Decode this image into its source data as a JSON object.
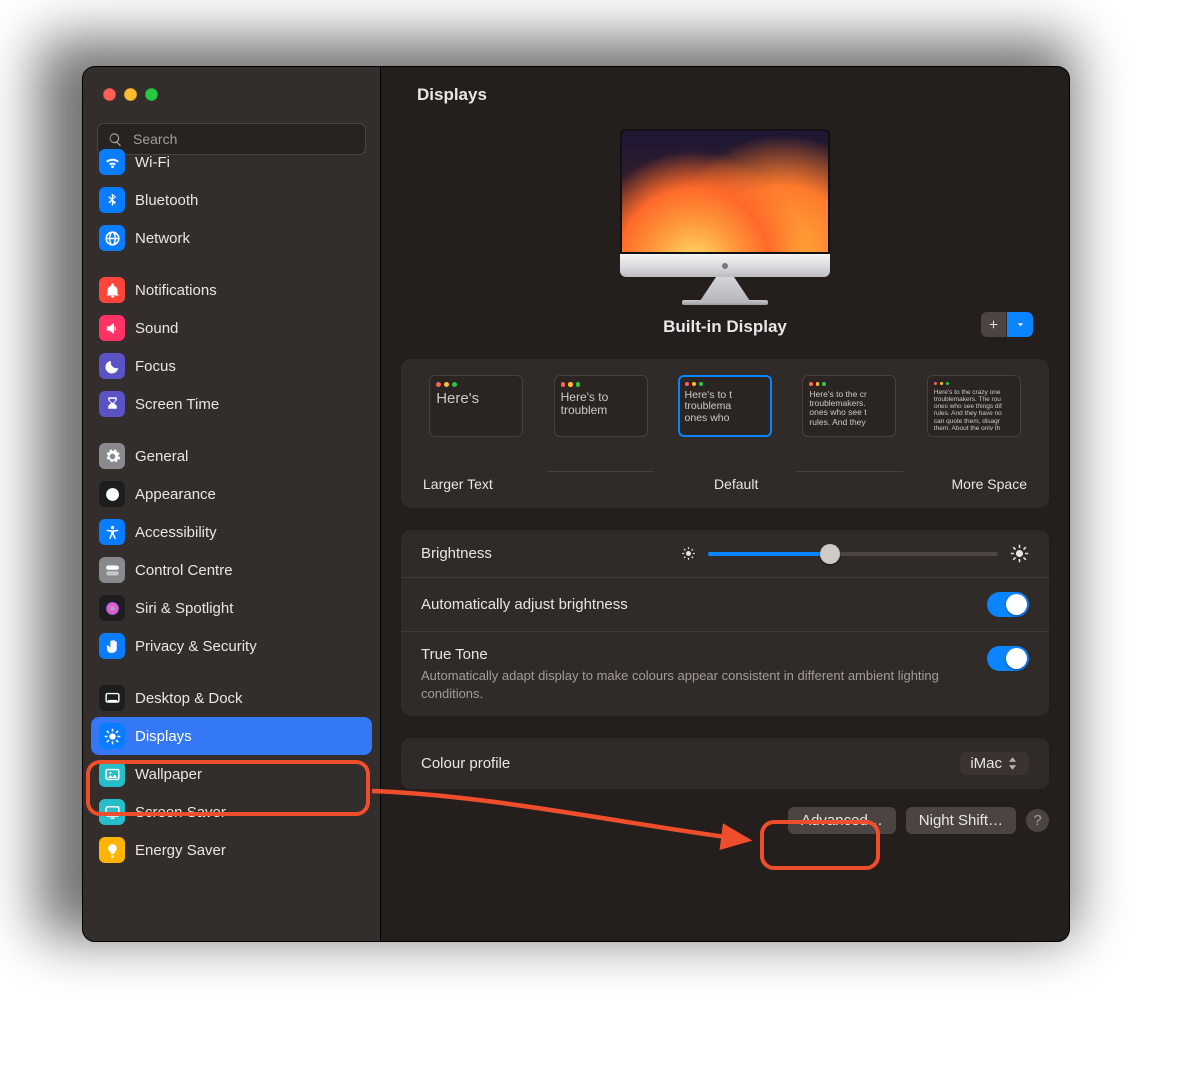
{
  "header": {
    "title": "Displays"
  },
  "search": {
    "placeholder": "Search"
  },
  "sidebar": {
    "groups": [
      [
        {
          "label": "Wi-Fi",
          "icon": "wifi",
          "bg": "#0a7cff"
        },
        {
          "label": "Bluetooth",
          "icon": "bluetooth",
          "bg": "#0a7cff"
        },
        {
          "label": "Network",
          "icon": "globe",
          "bg": "#0a7cff"
        }
      ],
      [
        {
          "label": "Notifications",
          "icon": "bell",
          "bg": "#ff453a"
        },
        {
          "label": "Sound",
          "icon": "speaker",
          "bg": "#ff3365"
        },
        {
          "label": "Focus",
          "icon": "moon",
          "bg": "#5a53c5"
        },
        {
          "label": "Screen Time",
          "icon": "hourglass",
          "bg": "#5a53c5"
        }
      ],
      [
        {
          "label": "General",
          "icon": "gear",
          "bg": "#8a8a8e"
        },
        {
          "label": "Appearance",
          "icon": "appearance",
          "bg": "#1d1d1f"
        },
        {
          "label": "Accessibility",
          "icon": "accessibility",
          "bg": "#0a7cff"
        },
        {
          "label": "Control Centre",
          "icon": "switches",
          "bg": "#8a8a8e"
        },
        {
          "label": "Siri & Spotlight",
          "icon": "siri",
          "bg": "#1d1d1f"
        },
        {
          "label": "Privacy & Security",
          "icon": "hand",
          "bg": "#0a7cff"
        }
      ],
      [
        {
          "label": "Desktop & Dock",
          "icon": "dock",
          "bg": "#1d1d1f"
        },
        {
          "label": "Displays",
          "icon": "sun",
          "bg": "#0a7cff",
          "selected": true
        },
        {
          "label": "Wallpaper",
          "icon": "photo",
          "bg": "#27beca"
        },
        {
          "label": "Screen Saver",
          "icon": "screensaver",
          "bg": "#27beca"
        },
        {
          "label": "Energy Saver",
          "icon": "bulb",
          "bg": "#ffb303"
        }
      ]
    ]
  },
  "display_name": "Built-in Display",
  "resolution": {
    "left_label": "Larger Text",
    "center_label": "Default",
    "right_label": "More Space",
    "samples": [
      "Here's",
      "Here's to\ntroublem",
      "Here's to t\ntroublema\nones who",
      "Here's to the cr\ntroublemakers.\nones who see t\nrules. And they",
      "Here's to the crazy one\ntroublemakers. The rou\nones who see things dif\nrules. And they have no\ncan quote them, disagr\nthem. About the only th\nBecause they change th"
    ],
    "selected_index": 2
  },
  "brightness": {
    "label": "Brightness",
    "value_pct": 42
  },
  "auto_brightness": {
    "label": "Automatically adjust brightness",
    "on": true
  },
  "true_tone": {
    "label": "True Tone",
    "desc": "Automatically adapt display to make colours appear consistent in different ambient lighting conditions.",
    "on": true
  },
  "colour_profile": {
    "label": "Colour profile",
    "value": "iMac"
  },
  "buttons": {
    "advanced": "Advanced…",
    "night_shift": "Night Shift…"
  },
  "colors": {
    "accent": "#3478f6",
    "annotation": "#ee4e2b"
  }
}
